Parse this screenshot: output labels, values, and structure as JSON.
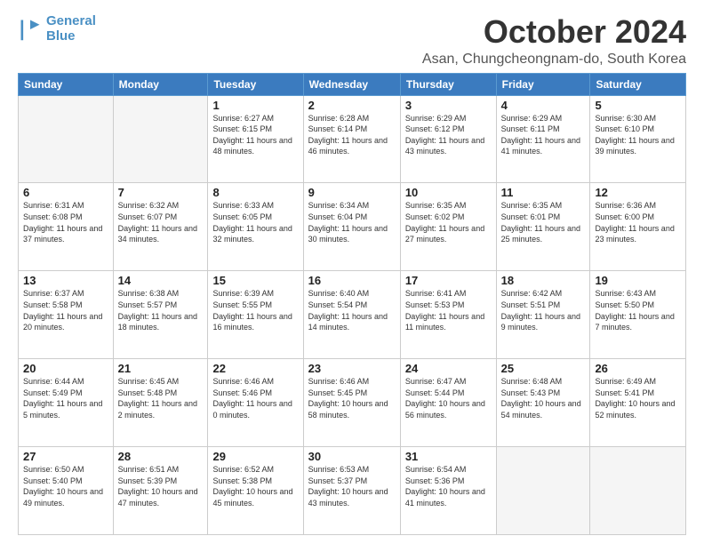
{
  "logo": {
    "line1": "General",
    "line2": "Blue"
  },
  "header": {
    "title": "October 2024",
    "subtitle": "Asan, Chungcheongnam-do, South Korea"
  },
  "weekdays": [
    "Sunday",
    "Monday",
    "Tuesday",
    "Wednesday",
    "Thursday",
    "Friday",
    "Saturday"
  ],
  "weeks": [
    [
      {
        "day": "",
        "info": ""
      },
      {
        "day": "",
        "info": ""
      },
      {
        "day": "1",
        "info": "Sunrise: 6:27 AM\nSunset: 6:15 PM\nDaylight: 11 hours and 48 minutes."
      },
      {
        "day": "2",
        "info": "Sunrise: 6:28 AM\nSunset: 6:14 PM\nDaylight: 11 hours and 46 minutes."
      },
      {
        "day": "3",
        "info": "Sunrise: 6:29 AM\nSunset: 6:12 PM\nDaylight: 11 hours and 43 minutes."
      },
      {
        "day": "4",
        "info": "Sunrise: 6:29 AM\nSunset: 6:11 PM\nDaylight: 11 hours and 41 minutes."
      },
      {
        "day": "5",
        "info": "Sunrise: 6:30 AM\nSunset: 6:10 PM\nDaylight: 11 hours and 39 minutes."
      }
    ],
    [
      {
        "day": "6",
        "info": "Sunrise: 6:31 AM\nSunset: 6:08 PM\nDaylight: 11 hours and 37 minutes."
      },
      {
        "day": "7",
        "info": "Sunrise: 6:32 AM\nSunset: 6:07 PM\nDaylight: 11 hours and 34 minutes."
      },
      {
        "day": "8",
        "info": "Sunrise: 6:33 AM\nSunset: 6:05 PM\nDaylight: 11 hours and 32 minutes."
      },
      {
        "day": "9",
        "info": "Sunrise: 6:34 AM\nSunset: 6:04 PM\nDaylight: 11 hours and 30 minutes."
      },
      {
        "day": "10",
        "info": "Sunrise: 6:35 AM\nSunset: 6:02 PM\nDaylight: 11 hours and 27 minutes."
      },
      {
        "day": "11",
        "info": "Sunrise: 6:35 AM\nSunset: 6:01 PM\nDaylight: 11 hours and 25 minutes."
      },
      {
        "day": "12",
        "info": "Sunrise: 6:36 AM\nSunset: 6:00 PM\nDaylight: 11 hours and 23 minutes."
      }
    ],
    [
      {
        "day": "13",
        "info": "Sunrise: 6:37 AM\nSunset: 5:58 PM\nDaylight: 11 hours and 20 minutes."
      },
      {
        "day": "14",
        "info": "Sunrise: 6:38 AM\nSunset: 5:57 PM\nDaylight: 11 hours and 18 minutes."
      },
      {
        "day": "15",
        "info": "Sunrise: 6:39 AM\nSunset: 5:55 PM\nDaylight: 11 hours and 16 minutes."
      },
      {
        "day": "16",
        "info": "Sunrise: 6:40 AM\nSunset: 5:54 PM\nDaylight: 11 hours and 14 minutes."
      },
      {
        "day": "17",
        "info": "Sunrise: 6:41 AM\nSunset: 5:53 PM\nDaylight: 11 hours and 11 minutes."
      },
      {
        "day": "18",
        "info": "Sunrise: 6:42 AM\nSunset: 5:51 PM\nDaylight: 11 hours and 9 minutes."
      },
      {
        "day": "19",
        "info": "Sunrise: 6:43 AM\nSunset: 5:50 PM\nDaylight: 11 hours and 7 minutes."
      }
    ],
    [
      {
        "day": "20",
        "info": "Sunrise: 6:44 AM\nSunset: 5:49 PM\nDaylight: 11 hours and 5 minutes."
      },
      {
        "day": "21",
        "info": "Sunrise: 6:45 AM\nSunset: 5:48 PM\nDaylight: 11 hours and 2 minutes."
      },
      {
        "day": "22",
        "info": "Sunrise: 6:46 AM\nSunset: 5:46 PM\nDaylight: 11 hours and 0 minutes."
      },
      {
        "day": "23",
        "info": "Sunrise: 6:46 AM\nSunset: 5:45 PM\nDaylight: 10 hours and 58 minutes."
      },
      {
        "day": "24",
        "info": "Sunrise: 6:47 AM\nSunset: 5:44 PM\nDaylight: 10 hours and 56 minutes."
      },
      {
        "day": "25",
        "info": "Sunrise: 6:48 AM\nSunset: 5:43 PM\nDaylight: 10 hours and 54 minutes."
      },
      {
        "day": "26",
        "info": "Sunrise: 6:49 AM\nSunset: 5:41 PM\nDaylight: 10 hours and 52 minutes."
      }
    ],
    [
      {
        "day": "27",
        "info": "Sunrise: 6:50 AM\nSunset: 5:40 PM\nDaylight: 10 hours and 49 minutes."
      },
      {
        "day": "28",
        "info": "Sunrise: 6:51 AM\nSunset: 5:39 PM\nDaylight: 10 hours and 47 minutes."
      },
      {
        "day": "29",
        "info": "Sunrise: 6:52 AM\nSunset: 5:38 PM\nDaylight: 10 hours and 45 minutes."
      },
      {
        "day": "30",
        "info": "Sunrise: 6:53 AM\nSunset: 5:37 PM\nDaylight: 10 hours and 43 minutes."
      },
      {
        "day": "31",
        "info": "Sunrise: 6:54 AM\nSunset: 5:36 PM\nDaylight: 10 hours and 41 minutes."
      },
      {
        "day": "",
        "info": ""
      },
      {
        "day": "",
        "info": ""
      }
    ]
  ]
}
